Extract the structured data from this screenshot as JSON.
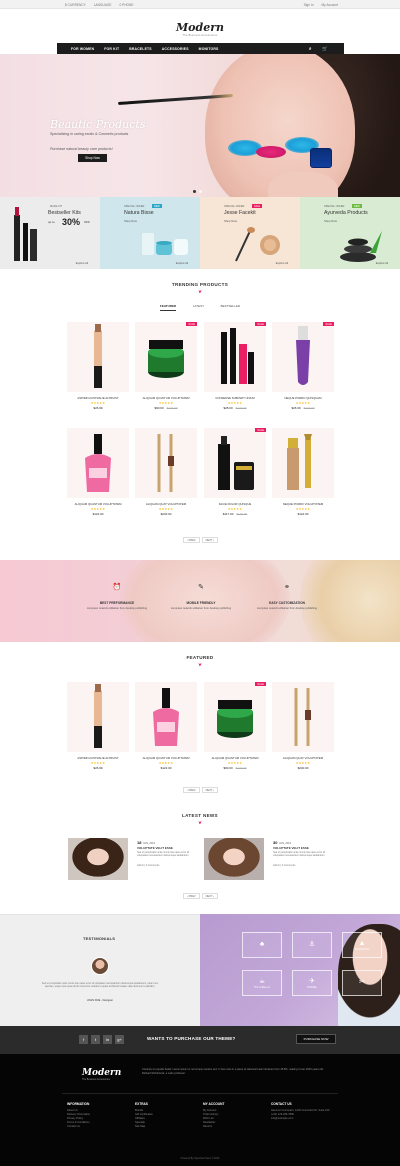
{
  "topbar": {
    "currency": "$ CURRENCY",
    "language": "LANGUAGE",
    "phone": "0 PHONE",
    "signin": "Sign In",
    "account": "My Account"
  },
  "header": {
    "logo_main": "Modern",
    "logo_tagline": "The Business Accessories"
  },
  "nav": {
    "items": [
      "FOR WOMEN",
      "FOR KIT",
      "BRACELETS",
      "ACCESSORIES",
      "MONITORS"
    ]
  },
  "hero": {
    "title": "Beautic Products",
    "subtitle": "Specializing in caring exotic & Cosmetic products",
    "tagline": "Purchase natural beauty care products!",
    "button": "Shop Now"
  },
  "banners": [
    {
      "small": "Make Kit",
      "title": "Bestseller Kits",
      "upto": "up to",
      "pct": "30%",
      "off": "OFF",
      "explore": "Explore All",
      "bg": "#ececec"
    },
    {
      "small": "Special Offer",
      "badge": "NEW",
      "title": "Natura Bisse",
      "shop": "Shop Now",
      "explore": "Explore All",
      "bg": "#cfe7ec",
      "badgecolor": "#2aa6c9"
    },
    {
      "small": "Special Offer",
      "badge": "SALE",
      "title": "Jesse Facekit",
      "shop": "Shop Now",
      "explore": "Explore All",
      "bg": "#f7e6d6",
      "badgecolor": "#e91e63"
    },
    {
      "small": "Special Offer",
      "badge": "NEW",
      "title": "Ayurveda Products",
      "shop": "Shop Now",
      "explore": "Explore All",
      "bg": "#d9ebd3",
      "badgecolor": "#6dbb3f"
    }
  ],
  "trending": {
    "title": "TRENDING PRODUCTS",
    "tabs": [
      "FEATURED",
      "LATEST",
      "BESTSELLER"
    ],
    "products": [
      {
        "name": "ASPIRIN AUSTRALIE ALTRUIST",
        "stars": "★★★★★",
        "price": "$26.99",
        "old": "",
        "sale": ""
      },
      {
        "name": "ALIQUAM QUANTUM VOLUPTATEM",
        "stars": "★★★★★",
        "price": "$90.00",
        "old": "$122.00",
        "sale": "SALE"
      },
      {
        "name": "CONSENSE SUBOWIT UNIUM",
        "stars": "★★★★★",
        "price": "$28.00",
        "old": "$122.00",
        "sale": "SALE"
      },
      {
        "name": "NEQUE PORRO QUISQUAM",
        "stars": "★★★★★",
        "price": "$26.99",
        "old": "$122.00",
        "sale": "SALE"
      },
      {
        "name": "ALIQUAM QUANTUM VOLUPTATEM",
        "stars": "★★★★★",
        "price": "$122.00",
        "old": "",
        "sale": ""
      },
      {
        "name": "ALIQUAM QUAT VOLUPTATEM",
        "stars": "★★★★★",
        "price": "$240.00",
        "old": "",
        "sale": ""
      },
      {
        "name": "FACIE DOLOR QUISQUE",
        "stars": "★★★★★",
        "price": "$117.00",
        "old": "$140.00",
        "sale": "SALE"
      },
      {
        "name": "NEQUE PORRO VOLUPTATEM",
        "stars": "★★★★★",
        "price": "$122.00",
        "old": "",
        "sale": ""
      }
    ],
    "pager": {
      "prev": "‹ PREV",
      "next": "NEXT ›"
    }
  },
  "features": [
    {
      "icon": "alarm-clock-icon",
      "glyph": "⏰",
      "title": "BEST PREFORMANCE",
      "text": "computes network utilitarian from desktop publishing"
    },
    {
      "icon": "edit-icon",
      "glyph": "✎",
      "title": "MOBILE FRIENDLY",
      "text": "computes network utilitarian from desktop publishing"
    },
    {
      "icon": "link-icon",
      "glyph": "⚭",
      "title": "EASY CUSTOMIZATION",
      "text": "computes network utilitarian from desktop publishing"
    }
  ],
  "featured": {
    "title": "FEATURED",
    "products": [
      {
        "name": "ASPIRIN AUSTRALIE ALTRUIST",
        "stars": "★★★★★",
        "price": "$26.99",
        "old": "",
        "sale": ""
      },
      {
        "name": "ALIQUAM QUANTUM VOLUPTATEM",
        "stars": "★★★★★",
        "price": "$122.00",
        "old": "",
        "sale": ""
      },
      {
        "name": "ALIQUAM QUANTUM VOLUPTATEM",
        "stars": "★★★★★",
        "price": "$90.00",
        "old": "$122.00",
        "sale": "SALE"
      },
      {
        "name": "ALIQUAM QUAT VOLUPTATEM",
        "stars": "★★★★★",
        "price": "$240.00",
        "old": "",
        "sale": ""
      }
    ],
    "pager": {
      "prev": "‹ PREV",
      "next": "NEXT ›"
    }
  },
  "news": {
    "title": "LATEST NEWS",
    "items": [
      {
        "day": "18",
        "month": "JAN, 2016",
        "title": "VOLUPTATE VELIT ESSE",
        "text": "Sed ut perspiciatis unde omnis iste natus error sit voluptatem accusantium doloremque laudantium",
        "meta": "Admin  |  0 Comments"
      },
      {
        "day": "30",
        "month": "JAN, 2016",
        "title": "VOLUPTATE VELIT ESSE",
        "text": "Sed ut perspiciatis unde omnis iste natus error sit voluptatem accusantium doloremque laudantium",
        "meta": "Admin  |  0 Comments"
      }
    ],
    "pager": {
      "prev": "‹ PREV",
      "next": "NEXT ›"
    }
  },
  "testimonials": {
    "title": "TESTIMONIALS",
    "text": "Sed ut perspiciatis unde omnis iste natus error sit voluptatem accusantium doloremque laudantium, totam rem aperiam, eaque ipsa quae ab illo inventore veritatis et quasi architecto beatae vitae dicta sunt explicabo.",
    "author": "JOHN DOE - Designer"
  },
  "brands": [
    {
      "label": "",
      "glyph": "♣"
    },
    {
      "label": "",
      "glyph": "⚓"
    },
    {
      "label": "MOUNTAIN",
      "glyph": "▲"
    },
    {
      "label": "The Coffee co",
      "glyph": "☕"
    },
    {
      "label": "TRAVEL",
      "glyph": "✈"
    },
    {
      "label": "",
      "glyph": "✂"
    }
  ],
  "purchase": {
    "text": "WANTS TO PURCHASE OUR THEME?",
    "button": "PURCHASE NOW",
    "social": [
      "f",
      "t",
      "in",
      "g+"
    ]
  },
  "footer": {
    "logo": "Modern",
    "tagline": "The Business Accessories",
    "desc": "Contrary to popular belief, Lorem Ipsum is not simply random text. It has roots in a piece of classical Latin literature from 45 BC, making it over 2000 years old. Richard McClintock, a Latin professor.",
    "columns": [
      {
        "title": "INFORMATION",
        "items": [
          "About Us",
          "Delivery Information",
          "Privacy Policy",
          "Terms & Conditions",
          "Contact Us"
        ]
      },
      {
        "title": "EXTRAS",
        "items": [
          "Brands",
          "Gift Certificates",
          "Affiliates",
          "Specials",
          "Site Map"
        ]
      },
      {
        "title": "MY ACCOUNT",
        "items": [
          "My Account",
          "Order History",
          "Wish List",
          "Newsletter",
          "Returns"
        ]
      },
      {
        "title": "CONTACT US",
        "items": [
          "Hanover Cosmetics, 1234 Cosmetics Dr, Suite 100",
          "(+91) 123-456-7890",
          "info@example.com"
        ]
      }
    ],
    "copyright": "Powered By OpenCart Store © 2016"
  },
  "colors": {
    "accent": "#e91e63",
    "dark": "#1c1c1c",
    "star": "#f5b301"
  }
}
